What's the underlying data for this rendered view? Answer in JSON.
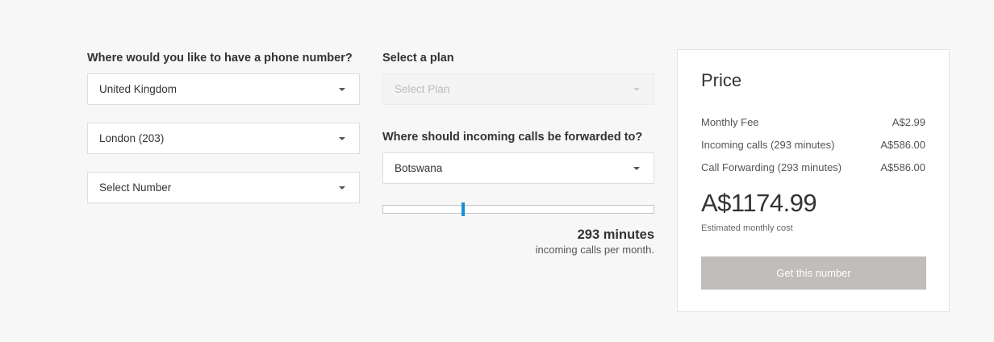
{
  "left": {
    "question": "Where would you like to have a phone number?",
    "country": "United Kingdom",
    "city": "London (203)",
    "number": "Select Number"
  },
  "middle": {
    "plan_label": "Select a plan",
    "plan_placeholder": "Select Plan",
    "forward_label": "Where should incoming calls be forwarded to?",
    "forward_country": "Botswana",
    "slider_value_fraction": 0.29,
    "minutes_value": "293 minutes",
    "minutes_caption": "incoming calls per month."
  },
  "price": {
    "title": "Price",
    "rows": [
      {
        "label": "Monthly Fee",
        "value": "A$2.99"
      },
      {
        "label": "Incoming calls (293 minutes)",
        "value": "A$586.00"
      },
      {
        "label": "Call Forwarding (293 minutes)",
        "value": "A$586.00"
      }
    ],
    "total": "A$1174.99",
    "total_caption": "Estimated monthly cost",
    "cta": "Get this number"
  },
  "colors": {
    "accent": "#1a8fd8",
    "cta_bg": "#c1bdbb",
    "page_bg": "#f7f7f7"
  }
}
